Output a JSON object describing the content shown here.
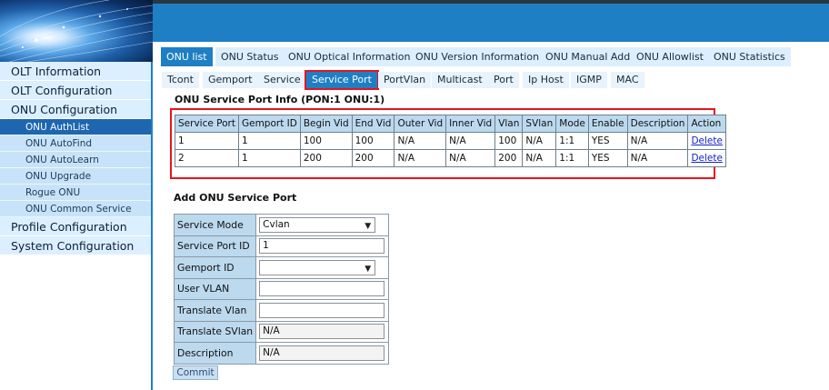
{
  "sidebar": {
    "items": [
      {
        "label": "OLT Information"
      },
      {
        "label": "OLT Configuration"
      },
      {
        "label": "ONU Configuration"
      }
    ],
    "sub_items": [
      {
        "label": "ONU AuthList",
        "active": true
      },
      {
        "label": "ONU AutoFind"
      },
      {
        "label": "ONU AutoLearn"
      },
      {
        "label": "ONU Upgrade"
      },
      {
        "label": "Rogue ONU"
      },
      {
        "label": "ONU Common Service"
      }
    ],
    "bottom_items": [
      {
        "label": "Profile Configuration"
      },
      {
        "label": "System Configuration"
      }
    ]
  },
  "tabs_primary": [
    "ONU list",
    "ONU Status",
    "ONU Optical Information",
    "ONU Version Information",
    "ONU Manual Add",
    "ONU Allowlist",
    "ONU Statistics"
  ],
  "tabs_secondary": [
    "Tcont",
    "Gemport",
    "Service",
    "Service Port",
    "PortVlan",
    "Multicast",
    "Port",
    "Ip Host",
    "IGMP",
    "MAC"
  ],
  "service_port_info": {
    "title": "ONU Service Port Info (PON:1 ONU:1)",
    "columns": [
      "Service Port",
      "Gemport ID",
      "Begin Vid",
      "End Vid",
      "Outer Vid",
      "Inner Vid",
      "Vlan",
      "SVlan",
      "Mode",
      "Enable",
      "Description",
      "Action"
    ],
    "rows": [
      [
        "1",
        "1",
        "100",
        "100",
        "N/A",
        "N/A",
        "100",
        "N/A",
        "1:1",
        "YES",
        "N/A",
        "Delete"
      ],
      [
        "2",
        "1",
        "200",
        "200",
        "N/A",
        "N/A",
        "200",
        "N/A",
        "1:1",
        "YES",
        "N/A",
        "Delete"
      ]
    ]
  },
  "add_form": {
    "title": "Add ONU Service Port",
    "service_mode_label": "Service Mode",
    "service_mode_value": "Cvlan",
    "service_port_id_label": "Service Port ID",
    "service_port_id_value": "1",
    "gemport_id_label": "Gemport ID",
    "gemport_id_value": "",
    "user_vlan_label": "User VLAN",
    "user_vlan_value": "",
    "translate_vlan_label": "Translate Vlan",
    "translate_vlan_value": "",
    "translate_svlan_label": "Translate SVlan",
    "translate_svlan_value": "N/A",
    "description_label": "Description",
    "description_value": "N/A",
    "commit_label": "Commit"
  },
  "colors": {
    "accent": "#1e7fc4",
    "highlight": "#e8141b",
    "header_cell": "#bcd9ee",
    "nav_bg": "#dcefff"
  }
}
